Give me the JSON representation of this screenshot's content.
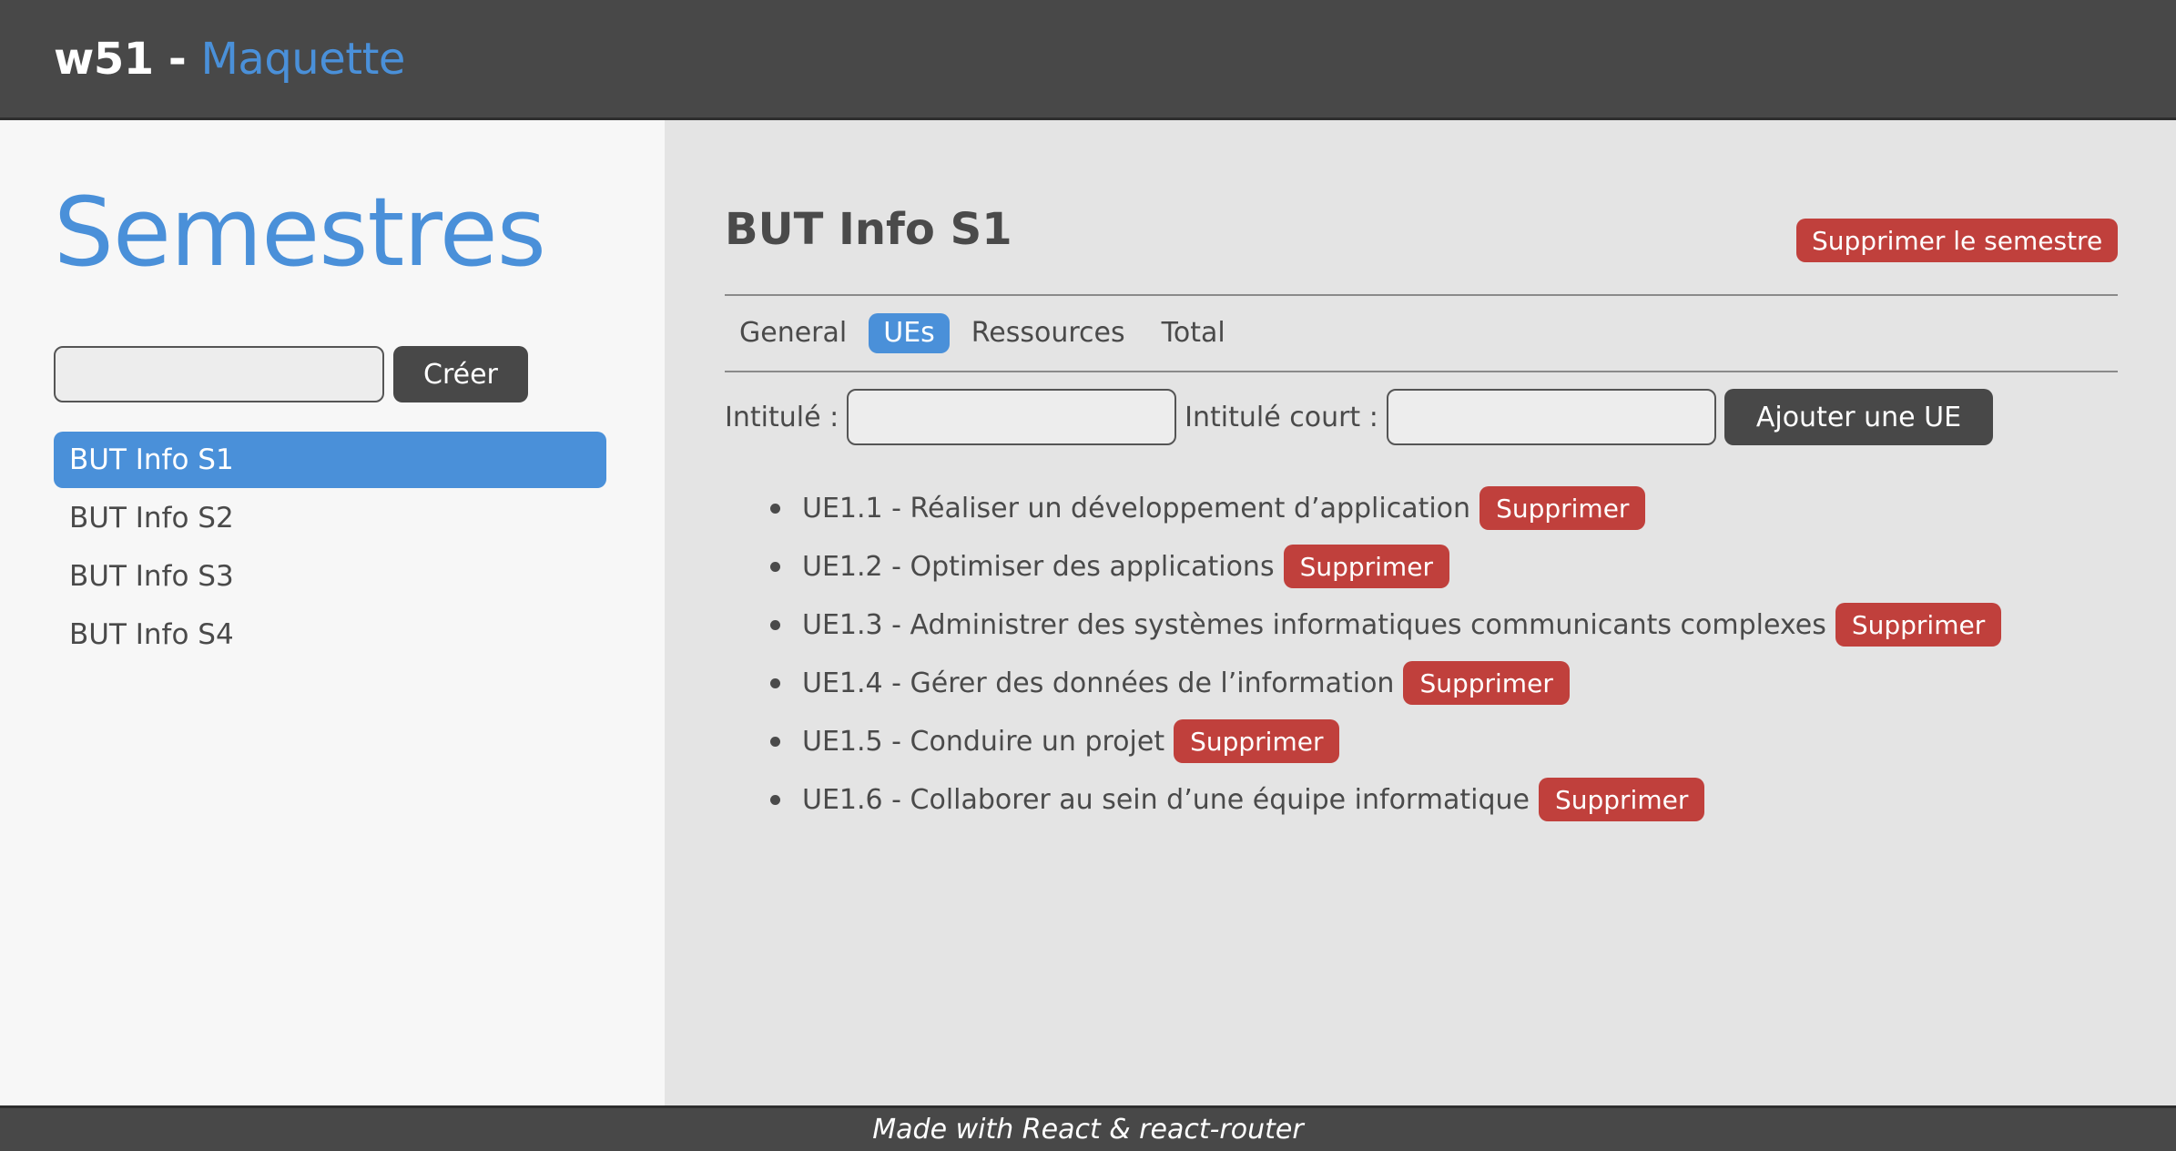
{
  "header": {
    "app_name": "w51",
    "separator": "-",
    "subtitle": "Maquette"
  },
  "sidebar": {
    "title": "Semestres",
    "create_input_value": "",
    "create_button": "Créer",
    "items": [
      {
        "label": "BUT Info S1",
        "active": true
      },
      {
        "label": "BUT Info S2",
        "active": false
      },
      {
        "label": "BUT Info S3",
        "active": false
      },
      {
        "label": "BUT Info S4",
        "active": false
      }
    ]
  },
  "main": {
    "title": "BUT Info S1",
    "delete_semester_button": "Supprimer le semestre",
    "tabs": [
      {
        "label": "General",
        "active": false
      },
      {
        "label": "UEs",
        "active": true
      },
      {
        "label": "Ressources",
        "active": false
      },
      {
        "label": "Total",
        "active": false
      }
    ],
    "form": {
      "intitule_label": "Intitulé :",
      "intitule_value": "",
      "intitule_court_label": "Intitulé court :",
      "intitule_court_value": "",
      "add_button": "Ajouter une UE"
    },
    "ues": [
      {
        "label": "UE1.1 - Réaliser un développement d’application",
        "delete": "Supprimer"
      },
      {
        "label": "UE1.2 - Optimiser des applications",
        "delete": "Supprimer"
      },
      {
        "label": "UE1.3 - Administrer des systèmes informatiques communicants complexes",
        "delete": "Supprimer"
      },
      {
        "label": "UE1.4 - Gérer des données de l’information",
        "delete": "Supprimer"
      },
      {
        "label": "UE1.5 - Conduire un projet",
        "delete": "Supprimer"
      },
      {
        "label": "UE1.6 - Collaborer au sein d’une équipe informatique",
        "delete": "Supprimer"
      }
    ]
  },
  "footer": {
    "text": "Made with React & react-router"
  },
  "colors": {
    "accent": "#4a90d9",
    "danger": "#c0403c",
    "dark": "#484848"
  }
}
